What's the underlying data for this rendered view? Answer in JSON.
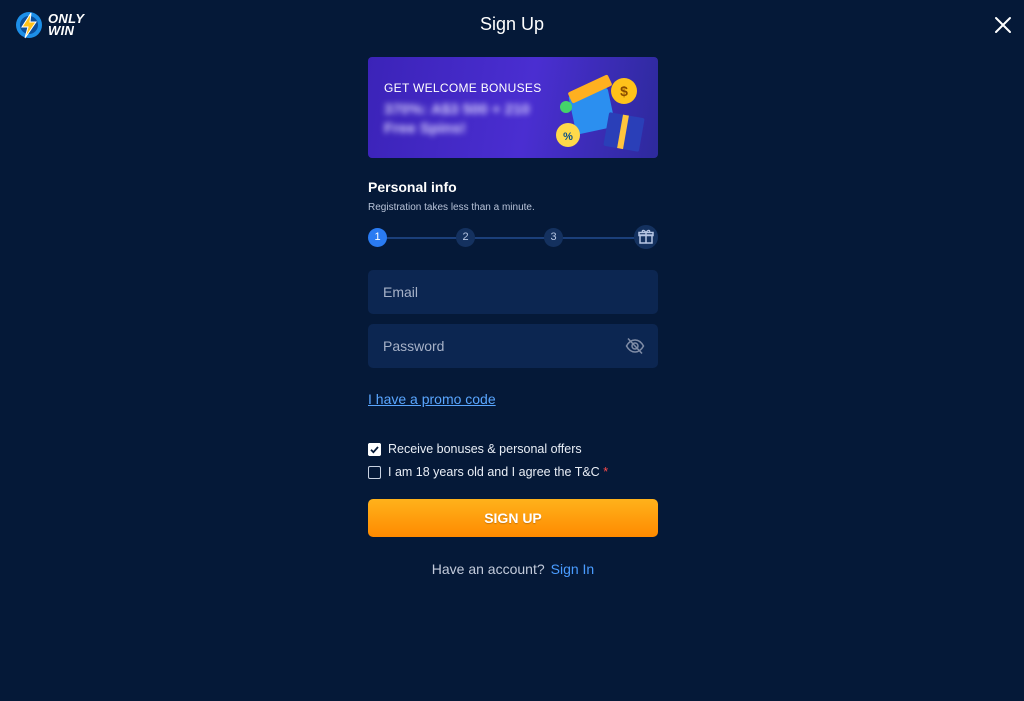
{
  "logo": {
    "line1": "ONLY",
    "line2": "WIN"
  },
  "header": {
    "title": "Sign Up"
  },
  "banner": {
    "heading": "GET WELCOME BONUSES",
    "bonus_text": "370%: A$3 500 + 210 Free Spins!"
  },
  "section": {
    "title": "Personal info",
    "subtitle": "Registration takes less than a minute."
  },
  "steps": [
    "1",
    "2",
    "3"
  ],
  "form": {
    "email_placeholder": "Email",
    "password_placeholder": "Password",
    "promo_link": "I have a promo code",
    "checkbox_bonuses": "Receive bonuses & personal offers",
    "checkbox_terms": "I am 18 years old and I agree the T&C",
    "required_mark": "*",
    "submit_label": "SIGN UP"
  },
  "footer": {
    "have_account": "Have an account?",
    "sign_in": "Sign In"
  },
  "colors": {
    "background": "#051938",
    "field": "#0c2651",
    "accent_blue": "#2a7bf2",
    "link": "#5aa6ff",
    "button_orange": "#ff9a00"
  },
  "icons": [
    "logo-icon",
    "close-icon",
    "gift-icon",
    "eye-off-icon",
    "checkbox-checked-icon"
  ]
}
